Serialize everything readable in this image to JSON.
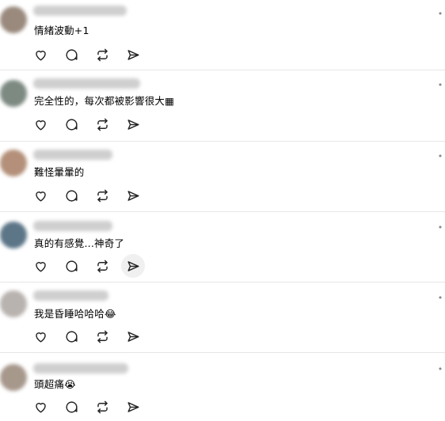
{
  "replies": [
    {
      "text": "情緒波動+1",
      "more_icon": "ellipsis-icon",
      "avatar_color": "#9a8a7d",
      "name_blur_color": "#c9c9c9",
      "actions": [
        "heart-icon",
        "comment-icon",
        "repost-icon",
        "share-icon"
      ]
    },
    {
      "text": "完全性的，每次都被影響很大▦",
      "more_icon": "ellipsis-icon",
      "avatar_color": "#7d8a82",
      "name_blur_color": "#c9c9c9",
      "actions": [
        "heart-icon",
        "comment-icon",
        "repost-icon",
        "share-icon"
      ]
    },
    {
      "text": "難怪暈暈的",
      "more_icon": "ellipsis-icon",
      "avatar_color": "#b4907a",
      "name_blur_color": "#c9c9c9",
      "actions": [
        "heart-icon",
        "comment-icon",
        "repost-icon",
        "share-icon"
      ]
    },
    {
      "text": "真的有感覺...神奇了",
      "more_icon": "ellipsis-icon",
      "avatar_color": "#5c7688",
      "name_blur_color": "#c9c9c9",
      "actions": [
        "heart-icon",
        "comment-icon",
        "repost-icon",
        "share-icon"
      ]
    },
    {
      "text": "我是昏睡哈哈哈😂",
      "more_icon": "ellipsis-icon",
      "avatar_color": "#b9b3b0",
      "name_blur_color": "#c9c9c9",
      "actions": [
        "heart-icon",
        "comment-icon",
        "repost-icon",
        "share-icon"
      ]
    },
    {
      "text": "頭超痛😭",
      "more_icon": "ellipsis-icon",
      "avatar_color": "#a7988c",
      "name_blur_color": "#c9c9c9",
      "actions": [
        "heart-icon",
        "comment-icon",
        "repost-icon",
        "share-icon"
      ]
    }
  ]
}
